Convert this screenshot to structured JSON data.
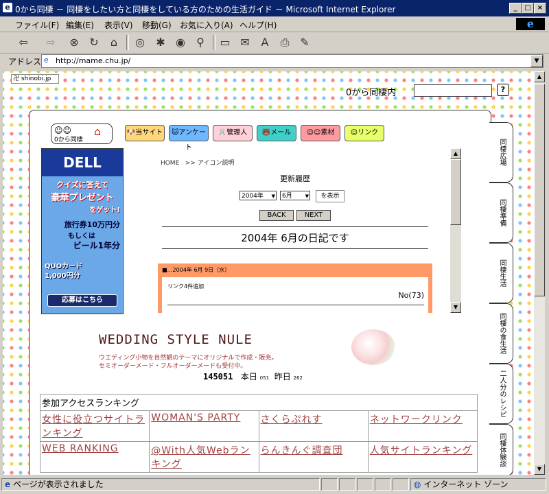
{
  "window": {
    "title": "0から同棲 － 同棲をしたい方と同棲をしている方のための生活ガイド － Microsoft Internet Explorer"
  },
  "menu": [
    "ファイル(F)",
    "編集(E)",
    "表示(V)",
    "移動(G)",
    "お気に入り(A)",
    "ヘルプ(H)"
  ],
  "address": {
    "label": "アドレス",
    "url": "http://mame.chu.jp/"
  },
  "page": {
    "shinobi": "shinobi.jp",
    "site_search_label": "0から同棲内",
    "search_help": "?",
    "logo_text": "0から同棲",
    "nav": [
      "当サイト",
      "アンケート",
      "管理人",
      "メール",
      "素材",
      "リンク"
    ],
    "side_tabs": [
      "同棲広場",
      "同棲準備",
      "同棲生活",
      "同棲の食生活",
      "二人分のレシピ",
      "同棲体験談"
    ],
    "ad": {
      "brand": "DELL",
      "line1": "クイズに答えて",
      "line2": "豪華プレゼント",
      "line3": "をゲット!",
      "line4": "旅行券10万円分",
      "line5": "もしくは",
      "line6": "ビール1年分",
      "line7": "QUOカード",
      "line8": "1,000円分",
      "button": "応募はこちら"
    },
    "breadcrumb": {
      "home": "HOME",
      "icon": "アイコン説明"
    },
    "history_title": "更新履歴",
    "year_select": "2004年",
    "month_select": "6月",
    "show_button": "を表示",
    "back_button": "BACK",
    "next_button": "NEXT",
    "diary_heading": "2004年 6月の日記です",
    "entry": {
      "date": "■…2004年 6月 9日（水）",
      "text": "リンク4件追加",
      "number": "No(73)"
    },
    "wedding": {
      "title": "WEDDING STYLE NULE",
      "desc1": "ウエディング小物を自然観のテーマにオリジナルで作成・販売。",
      "desc2": "セミオーダーメード・フルオーダーメードも受付中。"
    },
    "counter": {
      "total": "145051",
      "today_label": "本日",
      "today": "051",
      "yesterday_label": "昨日",
      "yesterday": "262"
    },
    "ranking": {
      "title": "参加アクセスランキング",
      "rows": [
        [
          "女性に役立つサイトランキング",
          "WOMAN'S PARTY",
          "さくらぷれす",
          "ネットワークリンク"
        ],
        [
          "WEB RANKING",
          "@With人気Webランキング",
          "らんきんぐ調査団",
          "人気サイトランキング"
        ]
      ]
    }
  },
  "status": {
    "text": "ページが表示されました",
    "zone": "インターネット ゾーン"
  },
  "colors": {
    "titlebar": "#0a246a",
    "chrome": "#d4d0c8",
    "entry_bar": "#ff9966"
  }
}
